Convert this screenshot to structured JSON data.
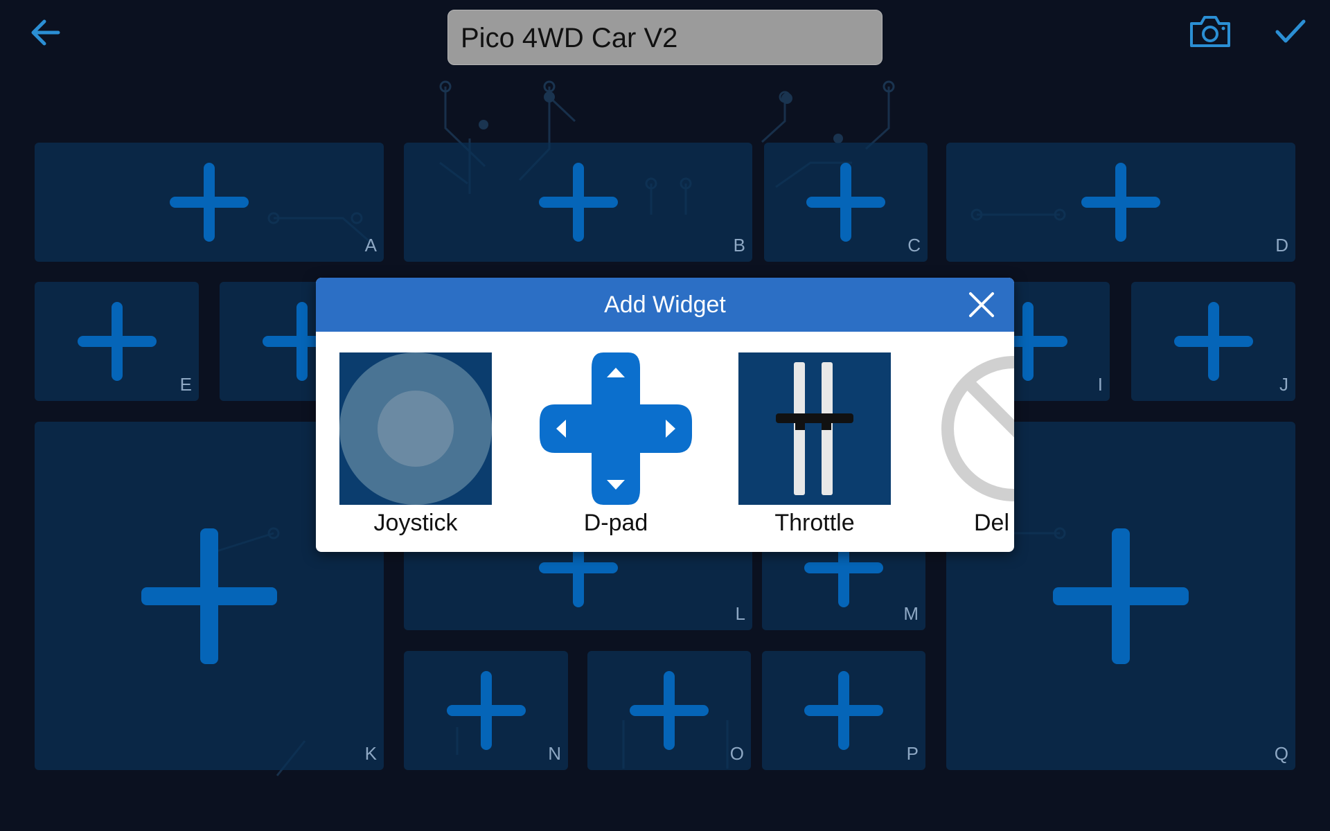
{
  "header": {
    "back_icon": "arrow-left-icon",
    "title_value": "Pico 4WD Car V2",
    "camera_icon": "camera-icon",
    "confirm_icon": "check-icon"
  },
  "slots": {
    "A": "A",
    "B": "B",
    "C": "C",
    "D": "D",
    "E": "E",
    "I": "I",
    "J": "J",
    "K": "K",
    "L": "L",
    "M": "M",
    "N": "N",
    "O": "O",
    "P": "P",
    "Q": "Q"
  },
  "modal": {
    "title": "Add Widget",
    "close_icon": "close-icon",
    "widgets": [
      {
        "label": "Joystick"
      },
      {
        "label": "D-pad"
      },
      {
        "label": "Throttle"
      },
      {
        "label": "Del"
      }
    ]
  },
  "colors": {
    "background": "#0b1120",
    "slot": "#0a3054",
    "plus": "#0565b8",
    "modal_header": "#2c6fc5",
    "accent": "#1f8fd6"
  }
}
